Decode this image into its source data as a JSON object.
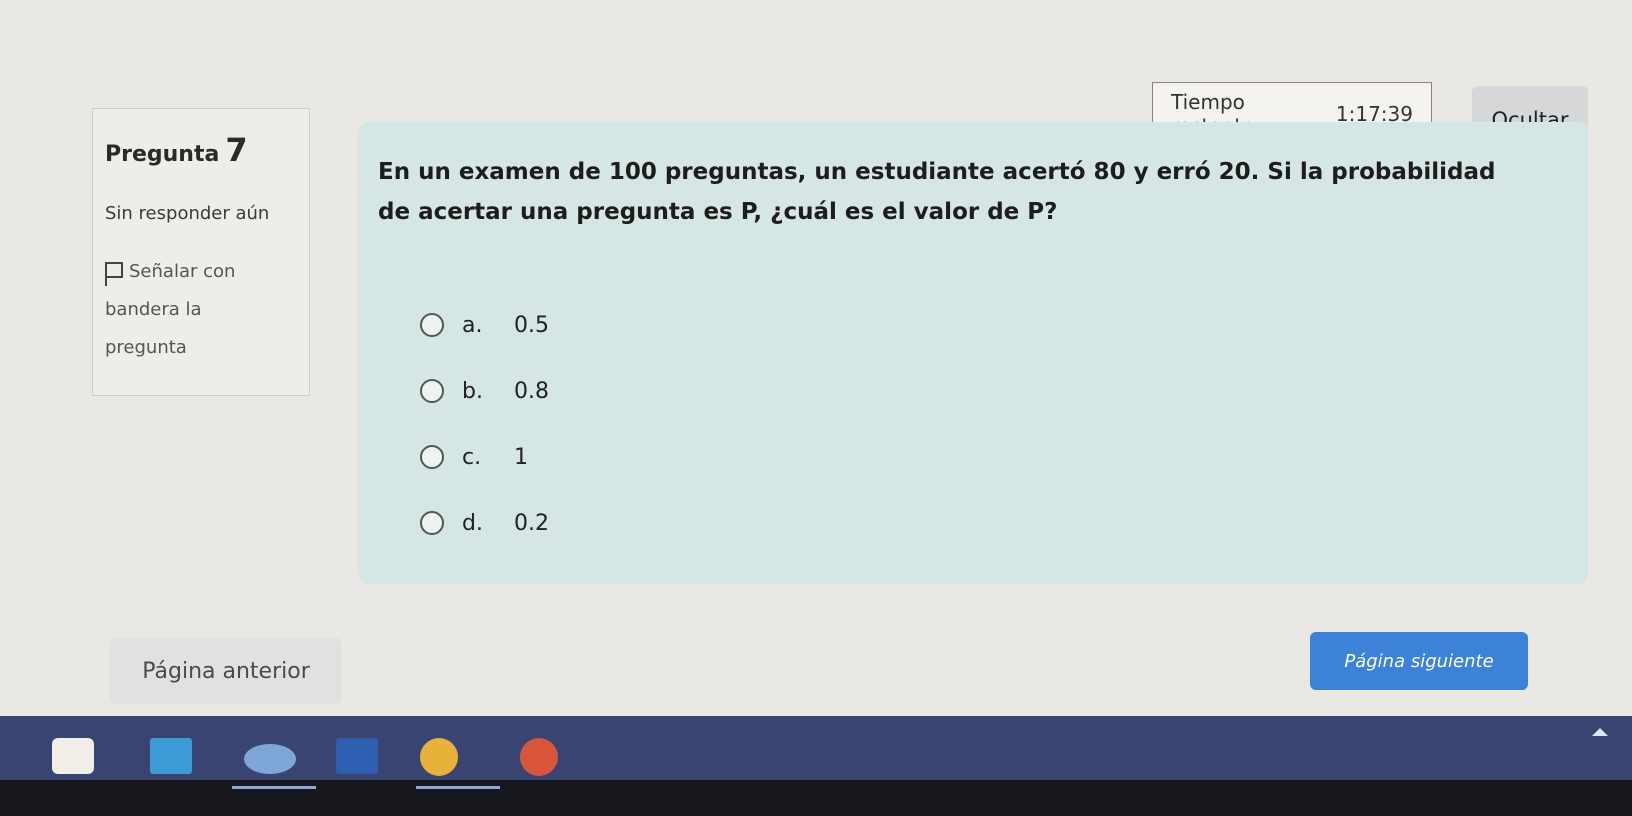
{
  "timer": {
    "label": "Tiempo restante",
    "value": "1:17:39"
  },
  "hide_button": "Ocultar",
  "question_info": {
    "title": "Pregunta",
    "number": "7",
    "status": "Sin responder aún",
    "flag_label": "Señalar con bandera la pregunta"
  },
  "question": {
    "text": "En un examen de 100 preguntas, un estudiante acertó 80 y erró 20. Si la probabilidad de acertar una pregunta es P, ¿cuál es el valor de P?",
    "options": [
      {
        "letter": "a.",
        "value": "0.5"
      },
      {
        "letter": "b.",
        "value": "0.8"
      },
      {
        "letter": "c.",
        "value": "1"
      },
      {
        "letter": "d.",
        "value": "0.2"
      }
    ]
  },
  "navigation": {
    "previous": "Página anterior",
    "next": "Página siguiente"
  },
  "taskbar": {
    "icons": [
      "store-icon",
      "mail-icon",
      "photos-icon",
      "word-icon",
      "chrome-icon",
      "powerpoint-icon"
    ]
  },
  "colors": {
    "content_bg": "#d6e6e4",
    "next_button": "#3b82d8",
    "taskbar": "#3a4470"
  }
}
